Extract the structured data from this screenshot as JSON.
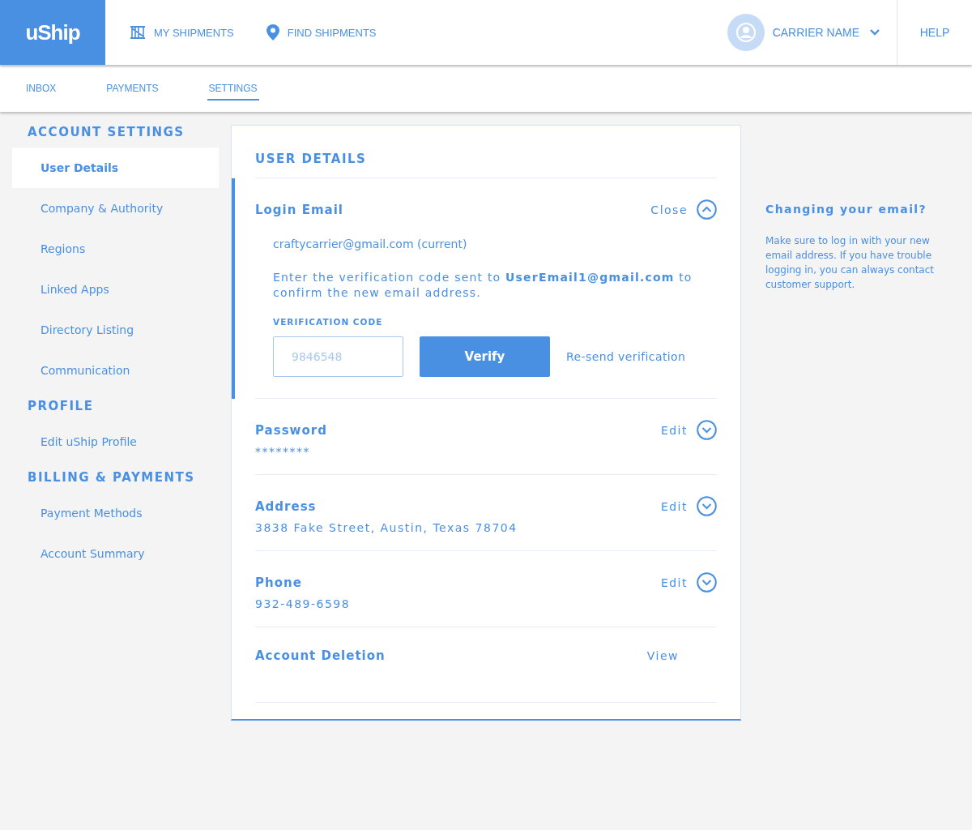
{
  "header": {
    "logo": "uShip",
    "nav": [
      {
        "label": "MY SHIPMENTS",
        "kind": "crate"
      },
      {
        "label": "FIND SHIPMENTS",
        "kind": "pin"
      }
    ],
    "user": "CARRIER NAME",
    "help": "HELP"
  },
  "subnav": [
    {
      "label": "INBOX",
      "selected": false
    },
    {
      "label": "PAYMENTS",
      "selected": false
    },
    {
      "label": "SETTINGS",
      "selected": true
    }
  ],
  "sidebar": [
    {
      "heading": "ACCOUNT SETTINGS",
      "items": [
        {
          "label": "User Details",
          "selected": true
        },
        {
          "label": "Company & Authority",
          "selected": false
        },
        {
          "label": "Regions",
          "selected": false
        },
        {
          "label": "Linked Apps",
          "selected": false
        },
        {
          "label": "Directory Listing",
          "selected": false
        },
        {
          "label": "Communication",
          "selected": false
        }
      ]
    },
    {
      "heading": "PROFILE",
      "items": [
        {
          "label": "Edit uShip Profile",
          "selected": false
        }
      ]
    },
    {
      "heading": "BILLING & PAYMENTS",
      "items": [
        {
          "label": "Payment Methods",
          "selected": false
        },
        {
          "label": "Account Summary",
          "selected": false
        }
      ]
    }
  ],
  "panel": {
    "title": "USER DETAILS",
    "sections": [
      {
        "label": "Login Email",
        "action": "Close",
        "expanded": true,
        "current": "craftycarrier@gmail.com (current)",
        "instructions": "Enter the verification code sent to **UserEmail1@gmail.com** to confirm the new email address.",
        "code_label": "VERIFICATION CODE",
        "code_placeholder": "9846548",
        "verify": "Verify",
        "resend": "Re-send verification"
      },
      {
        "label": "Password",
        "action": "Edit",
        "expanded": false,
        "value": "********"
      },
      {
        "label": "Address",
        "action": "Edit",
        "expanded": false,
        "value": "3838 Fake Street, Austin, Texas 78704"
      },
      {
        "label": "Phone",
        "action": "Edit",
        "expanded": false,
        "value": "932-489-6598"
      },
      {
        "label": "Account Deletion",
        "action": "View"
      }
    ]
  },
  "help_box": {
    "title": "Changing your email?",
    "text": "Make sure to log in with your new email address. If you have trouble logging in, you can always contact customer support."
  }
}
